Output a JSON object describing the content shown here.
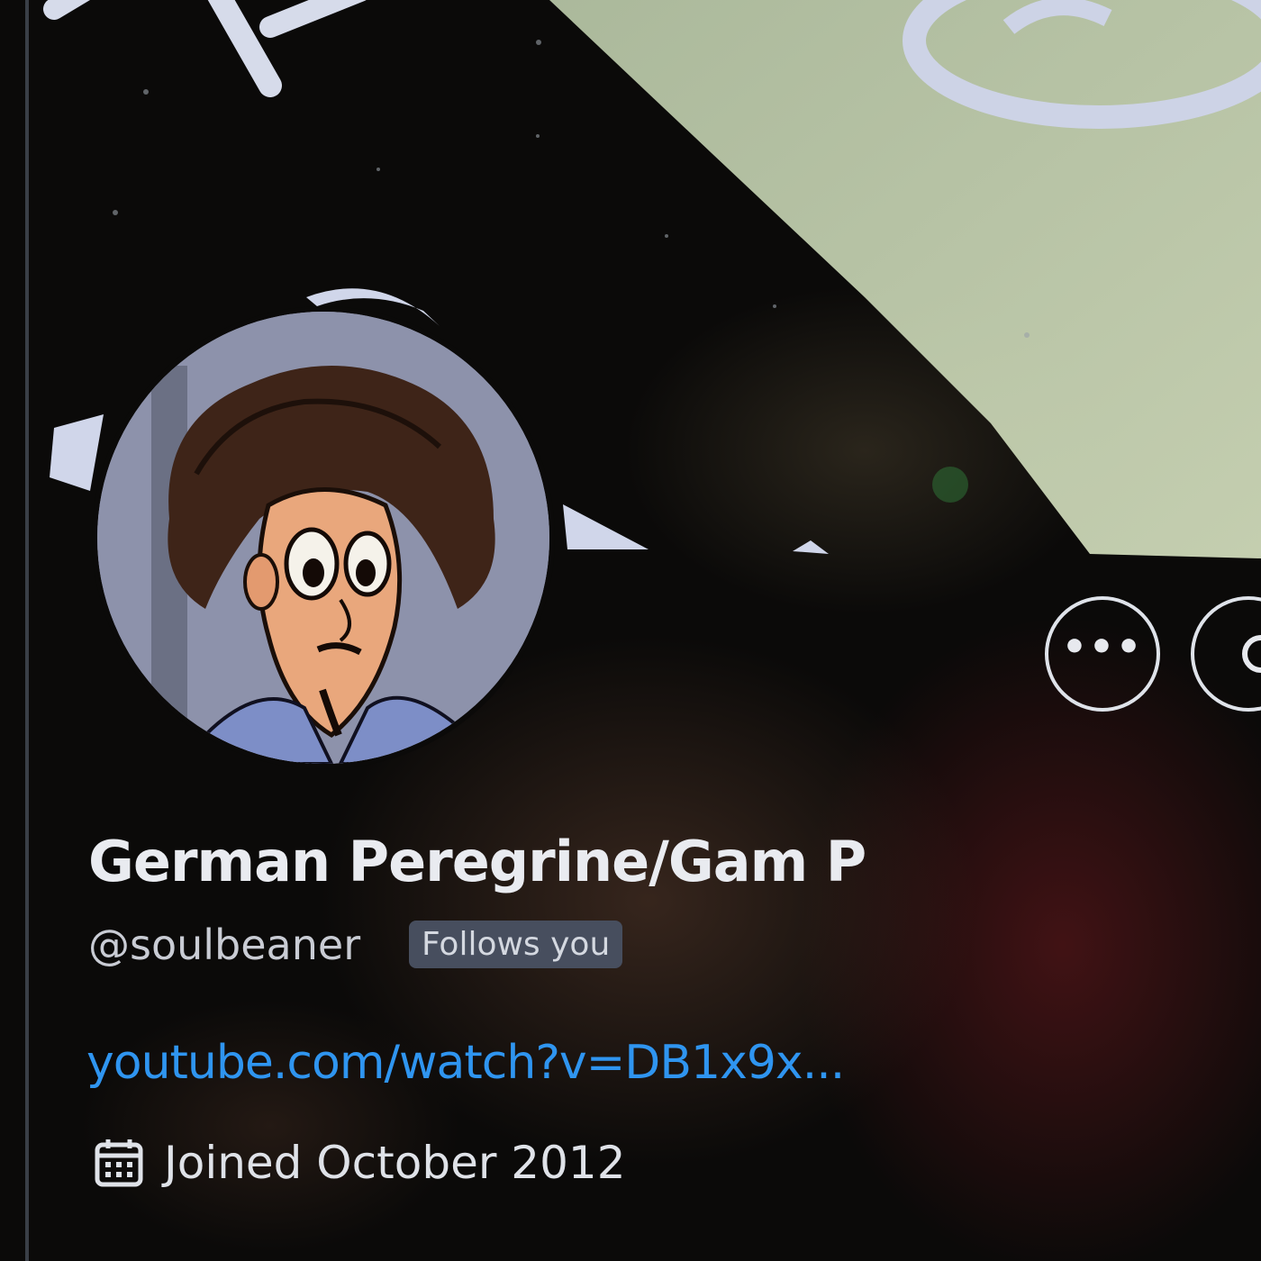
{
  "profile": {
    "display_name": "German Peregrine/Gam P",
    "handle": "@soulbeaner",
    "follows_you_badge": "Follows you",
    "website_link": "youtube.com/watch?v=DB1x9x...",
    "joined": "Joined October 2012"
  },
  "icons": {
    "calendar": "calendar-icon",
    "more": "more-options-icon"
  },
  "colors": {
    "link": "#2f95f0",
    "badge_bg": "#474e5e",
    "text_primary": "#e9ebf0",
    "text_secondary": "#c9ccd4"
  }
}
